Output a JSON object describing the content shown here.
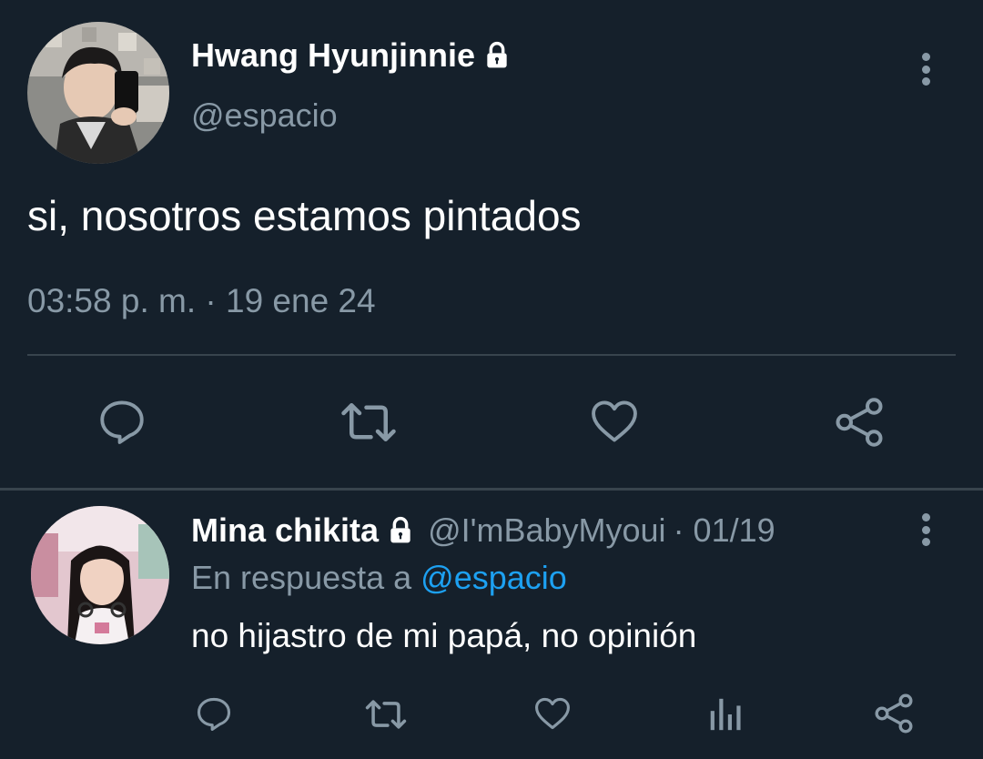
{
  "main_tweet": {
    "display_name": "Hwang Hyunjinnie",
    "handle": "@espacio",
    "text": "si, nosotros estamos pintados",
    "timestamp": "03:58 p. m. · 19 ene 24",
    "protected_icon": "lock-icon",
    "actions": [
      "reply-icon",
      "retweet-icon",
      "like-icon",
      "share-icon"
    ]
  },
  "reply_tweet": {
    "display_name": "Mina chikita",
    "handle": "@I'mBabyMyoui",
    "date": "· 01/19",
    "reply_prefix": "En respuesta a",
    "reply_to": "@espacio",
    "text": "no hijastro de mi papá, no opinión",
    "protected_icon": "lock-icon",
    "actions": [
      "reply-icon",
      "retweet-icon",
      "like-icon",
      "analytics-icon",
      "share-icon"
    ]
  },
  "colors": {
    "background": "#15202b",
    "text": "#ffffff",
    "muted": "#8899a6",
    "link": "#1da1f2",
    "divider": "#38444d"
  }
}
